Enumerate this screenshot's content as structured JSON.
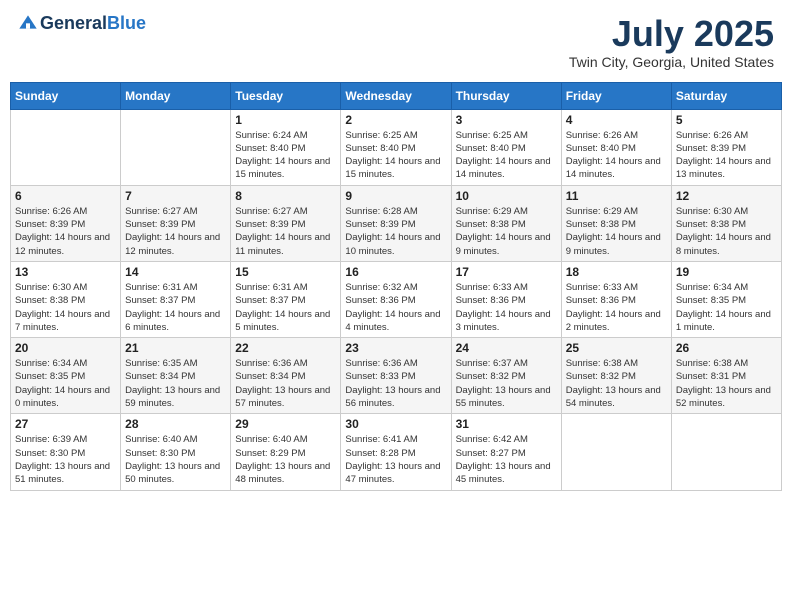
{
  "header": {
    "logo_general": "General",
    "logo_blue": "Blue",
    "month_title": "July 2025",
    "subtitle": "Twin City, Georgia, United States"
  },
  "days_of_week": [
    "Sunday",
    "Monday",
    "Tuesday",
    "Wednesday",
    "Thursday",
    "Friday",
    "Saturday"
  ],
  "weeks": [
    [
      {
        "day": "",
        "info": ""
      },
      {
        "day": "",
        "info": ""
      },
      {
        "day": "1",
        "info": "Sunrise: 6:24 AM\nSunset: 8:40 PM\nDaylight: 14 hours and 15 minutes."
      },
      {
        "day": "2",
        "info": "Sunrise: 6:25 AM\nSunset: 8:40 PM\nDaylight: 14 hours and 15 minutes."
      },
      {
        "day": "3",
        "info": "Sunrise: 6:25 AM\nSunset: 8:40 PM\nDaylight: 14 hours and 14 minutes."
      },
      {
        "day": "4",
        "info": "Sunrise: 6:26 AM\nSunset: 8:40 PM\nDaylight: 14 hours and 14 minutes."
      },
      {
        "day": "5",
        "info": "Sunrise: 6:26 AM\nSunset: 8:39 PM\nDaylight: 14 hours and 13 minutes."
      }
    ],
    [
      {
        "day": "6",
        "info": "Sunrise: 6:26 AM\nSunset: 8:39 PM\nDaylight: 14 hours and 12 minutes."
      },
      {
        "day": "7",
        "info": "Sunrise: 6:27 AM\nSunset: 8:39 PM\nDaylight: 14 hours and 12 minutes."
      },
      {
        "day": "8",
        "info": "Sunrise: 6:27 AM\nSunset: 8:39 PM\nDaylight: 14 hours and 11 minutes."
      },
      {
        "day": "9",
        "info": "Sunrise: 6:28 AM\nSunset: 8:39 PM\nDaylight: 14 hours and 10 minutes."
      },
      {
        "day": "10",
        "info": "Sunrise: 6:29 AM\nSunset: 8:38 PM\nDaylight: 14 hours and 9 minutes."
      },
      {
        "day": "11",
        "info": "Sunrise: 6:29 AM\nSunset: 8:38 PM\nDaylight: 14 hours and 9 minutes."
      },
      {
        "day": "12",
        "info": "Sunrise: 6:30 AM\nSunset: 8:38 PM\nDaylight: 14 hours and 8 minutes."
      }
    ],
    [
      {
        "day": "13",
        "info": "Sunrise: 6:30 AM\nSunset: 8:38 PM\nDaylight: 14 hours and 7 minutes."
      },
      {
        "day": "14",
        "info": "Sunrise: 6:31 AM\nSunset: 8:37 PM\nDaylight: 14 hours and 6 minutes."
      },
      {
        "day": "15",
        "info": "Sunrise: 6:31 AM\nSunset: 8:37 PM\nDaylight: 14 hours and 5 minutes."
      },
      {
        "day": "16",
        "info": "Sunrise: 6:32 AM\nSunset: 8:36 PM\nDaylight: 14 hours and 4 minutes."
      },
      {
        "day": "17",
        "info": "Sunrise: 6:33 AM\nSunset: 8:36 PM\nDaylight: 14 hours and 3 minutes."
      },
      {
        "day": "18",
        "info": "Sunrise: 6:33 AM\nSunset: 8:36 PM\nDaylight: 14 hours and 2 minutes."
      },
      {
        "day": "19",
        "info": "Sunrise: 6:34 AM\nSunset: 8:35 PM\nDaylight: 14 hours and 1 minute."
      }
    ],
    [
      {
        "day": "20",
        "info": "Sunrise: 6:34 AM\nSunset: 8:35 PM\nDaylight: 14 hours and 0 minutes."
      },
      {
        "day": "21",
        "info": "Sunrise: 6:35 AM\nSunset: 8:34 PM\nDaylight: 13 hours and 59 minutes."
      },
      {
        "day": "22",
        "info": "Sunrise: 6:36 AM\nSunset: 8:34 PM\nDaylight: 13 hours and 57 minutes."
      },
      {
        "day": "23",
        "info": "Sunrise: 6:36 AM\nSunset: 8:33 PM\nDaylight: 13 hours and 56 minutes."
      },
      {
        "day": "24",
        "info": "Sunrise: 6:37 AM\nSunset: 8:32 PM\nDaylight: 13 hours and 55 minutes."
      },
      {
        "day": "25",
        "info": "Sunrise: 6:38 AM\nSunset: 8:32 PM\nDaylight: 13 hours and 54 minutes."
      },
      {
        "day": "26",
        "info": "Sunrise: 6:38 AM\nSunset: 8:31 PM\nDaylight: 13 hours and 52 minutes."
      }
    ],
    [
      {
        "day": "27",
        "info": "Sunrise: 6:39 AM\nSunset: 8:30 PM\nDaylight: 13 hours and 51 minutes."
      },
      {
        "day": "28",
        "info": "Sunrise: 6:40 AM\nSunset: 8:30 PM\nDaylight: 13 hours and 50 minutes."
      },
      {
        "day": "29",
        "info": "Sunrise: 6:40 AM\nSunset: 8:29 PM\nDaylight: 13 hours and 48 minutes."
      },
      {
        "day": "30",
        "info": "Sunrise: 6:41 AM\nSunset: 8:28 PM\nDaylight: 13 hours and 47 minutes."
      },
      {
        "day": "31",
        "info": "Sunrise: 6:42 AM\nSunset: 8:27 PM\nDaylight: 13 hours and 45 minutes."
      },
      {
        "day": "",
        "info": ""
      },
      {
        "day": "",
        "info": ""
      }
    ]
  ]
}
